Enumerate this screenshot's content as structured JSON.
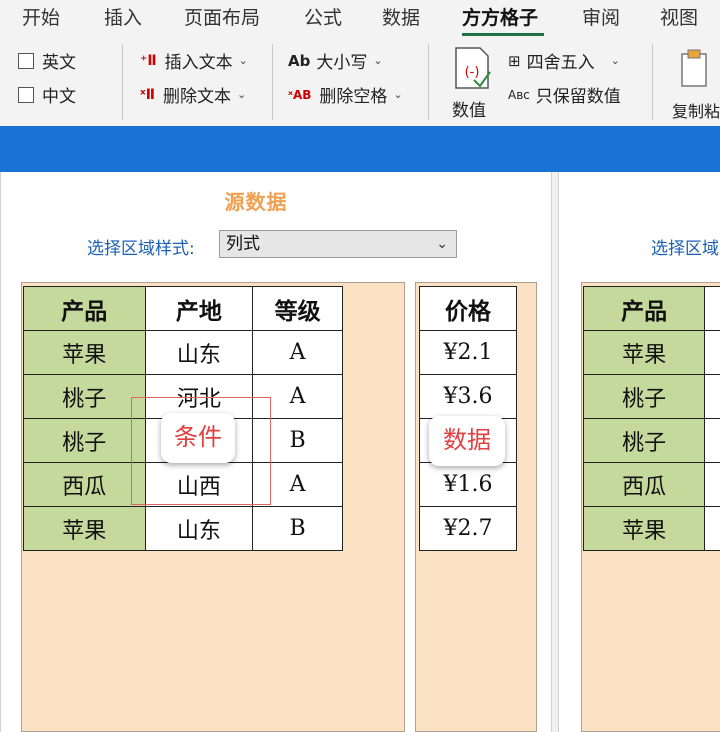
{
  "ribbon_tabs": [
    "开始",
    "插入",
    "页面布局",
    "公式",
    "数据",
    "方方格子",
    "审阅",
    "视图"
  ],
  "ribbon": {
    "checkbox_english": "英文",
    "checkbox_chinese": "中文",
    "insert_text": "插入文本",
    "delete_text": "删除文本",
    "case_label": "大小写",
    "delete_spaces": "删除空格",
    "numeric_label": "数值",
    "round_label": "四舍五入",
    "keep_values": "只保留数值",
    "copy_paste": "复制粘"
  },
  "dialog": {
    "source_title": "源数据",
    "select_style_label": "选择区域样式:",
    "select_style_value": "列式",
    "select_style_label_right": "选择区域",
    "condition_badge": "条件",
    "data_badge": "数据"
  },
  "table_headers": [
    "产品",
    "产地",
    "等级"
  ],
  "table_rows": [
    [
      "苹果",
      "山东",
      "A"
    ],
    [
      "桃子",
      "河北",
      "A"
    ],
    [
      "桃子",
      "",
      "B"
    ],
    [
      "西瓜",
      "山西",
      "A"
    ],
    [
      "苹果",
      "山东",
      "B"
    ]
  ],
  "price_header": "价格",
  "prices": [
    "¥2.1",
    "¥3.6",
    "",
    "¥1.6",
    "¥2.7"
  ],
  "right_header": "产品",
  "right_products": [
    "苹果",
    "桃子",
    "桃子",
    "西瓜",
    "苹果"
  ],
  "colors": {
    "accent_blue": "#1a73d4",
    "header_green": "#c4d99b",
    "area_peach": "#fbe2c4",
    "badge_red": "#e04040"
  }
}
